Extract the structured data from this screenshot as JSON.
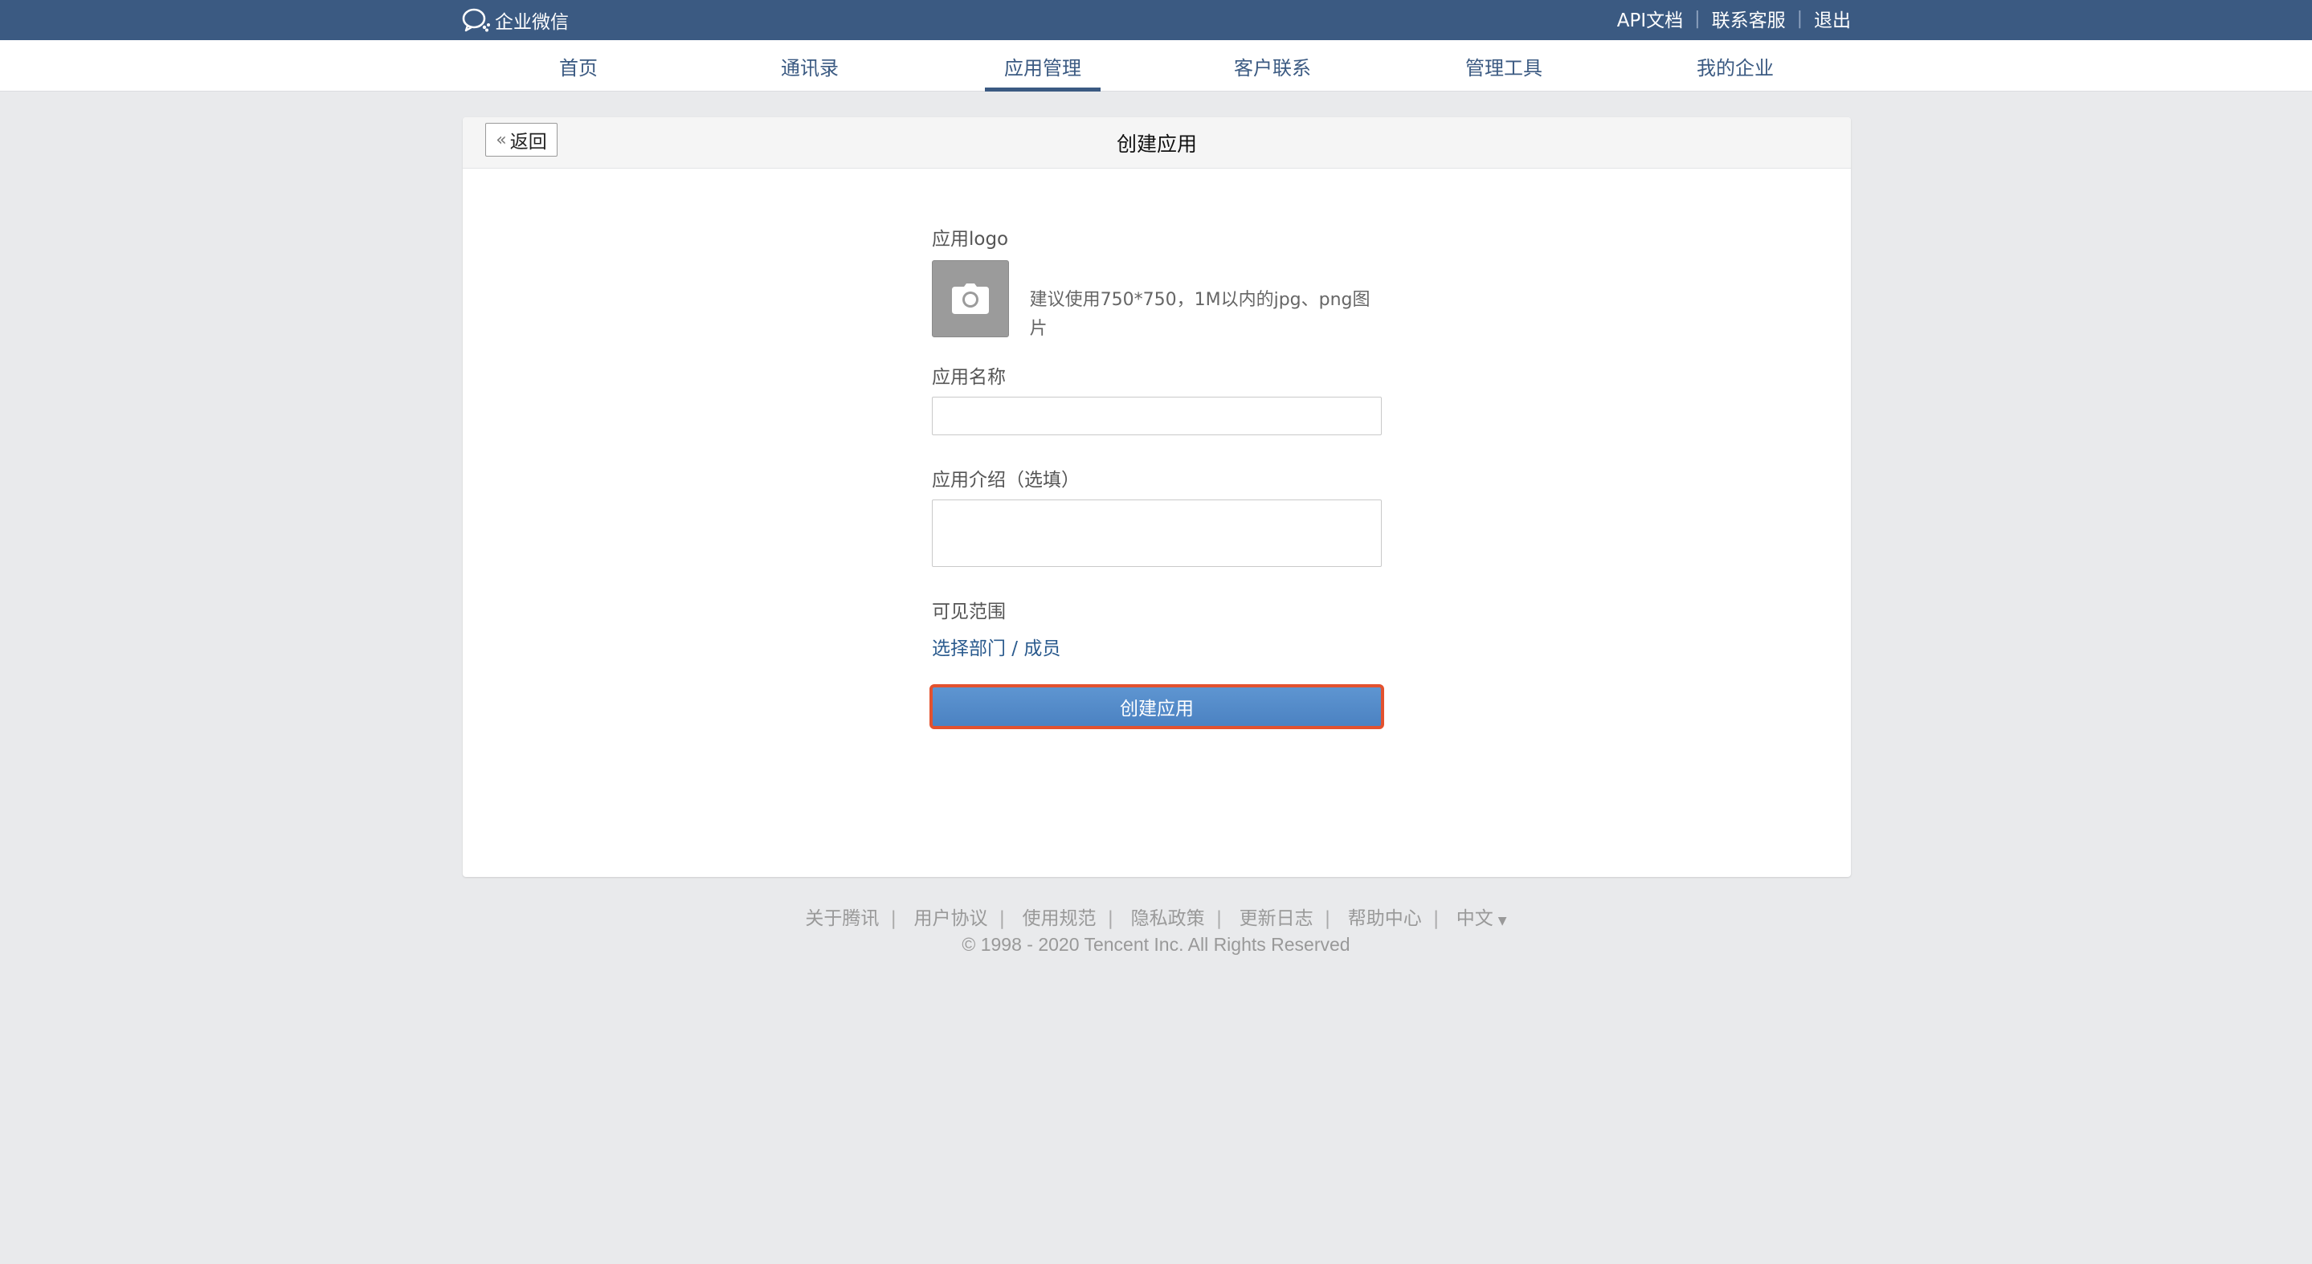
{
  "topbar": {
    "brand": "企业微信",
    "links": [
      "API文档",
      "联系客服",
      "退出"
    ]
  },
  "nav": {
    "items": [
      "首页",
      "通讯录",
      "应用管理",
      "客户联系",
      "管理工具",
      "我的企业"
    ],
    "active": "应用管理"
  },
  "panel": {
    "back_label": "返回",
    "title": "创建应用"
  },
  "form": {
    "logo_label": "应用logo",
    "logo_tip": "建议使用750*750，1M以内的jpg、png图片",
    "name_label": "应用名称",
    "name_value": "",
    "desc_label": "应用介绍（选填）",
    "desc_value": "",
    "scope_label": "可见范围",
    "scope_link": "选择部门 / 成员",
    "submit_label": "创建应用"
  },
  "footer": {
    "links": [
      "关于腾讯",
      "用户协议",
      "使用规范",
      "隐私政策",
      "更新日志",
      "帮助中心"
    ],
    "language": "中文",
    "copyright": "© 1998 - 2020 Tencent Inc. All Rights Reserved"
  },
  "colors": {
    "topbar": "#3b5a82",
    "accent": "#3b5a82",
    "button": "#4b82c2",
    "highlight_border": "#e3522f",
    "page_bg": "#e9eaec"
  }
}
